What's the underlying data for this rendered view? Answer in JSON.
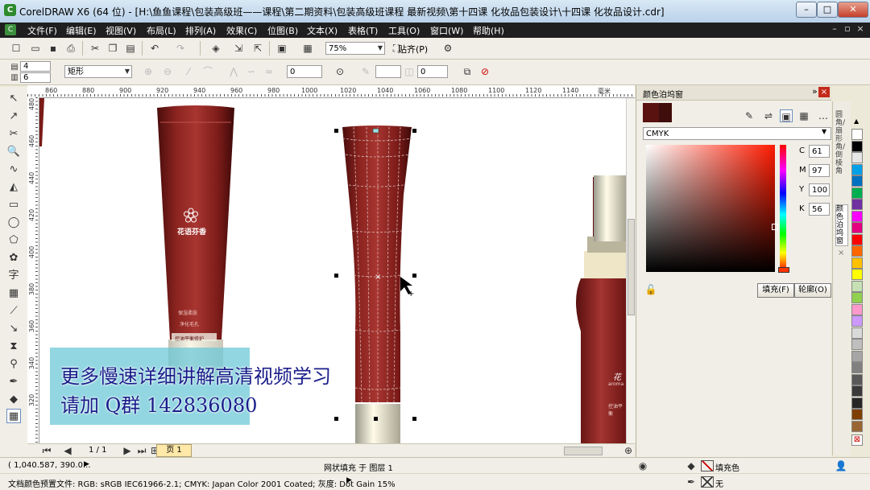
{
  "window": {
    "title": "CorelDRAW X6 (64 位) - [H:\\鱼鱼课程\\包装高级班——课程\\第二期资料\\包装高级班课程 最新视频\\第十四课 化妆品包装设计\\十四课 化妆品设计.cdr]",
    "minimize": "–",
    "maximize": "□",
    "close": "✕"
  },
  "menu": {
    "items": [
      "文件(F)",
      "编辑(E)",
      "视图(V)",
      "布局(L)",
      "排列(A)",
      "效果(C)",
      "位图(B)",
      "文本(X)",
      "表格(T)",
      "工具(O)",
      "窗口(W)",
      "帮助(H)"
    ]
  },
  "toolbar": {
    "zoom_value": "75%",
    "snap_label": "贴齐(P)"
  },
  "propbar": {
    "rows_value": "4",
    "cols_value": "6",
    "shape_select": "矩形",
    "angle_value": "0",
    "transparency_value": "0"
  },
  "ruler": {
    "h_ticks": [
      "860",
      "880",
      "900",
      "920",
      "940",
      "960",
      "980",
      "1000",
      "1020",
      "1040",
      "1060",
      "1080",
      "1100",
      "1120",
      "1140"
    ],
    "h_unit": "毫米",
    "v_ticks": [
      "480",
      "460",
      "440",
      "420",
      "400",
      "380",
      "360",
      "340",
      "320"
    ]
  },
  "canvas": {
    "tube_brand": "花语芬香",
    "tube_small1": "保湿柔肤",
    "tube_small2": "净化毛孔",
    "tube_small3": "控油平衡修护",
    "right_brand": "花",
    "right_small1": "aroma",
    "right_small2": "控油平衡"
  },
  "overlay": {
    "line1": "更多慢速详细讲解高清视频学习",
    "line2": "请加  Q群  142836080"
  },
  "docker": {
    "title": "颜色泊坞窗",
    "color_model": "CMYK",
    "c_label": "C",
    "c_value": "61",
    "m_label": "M",
    "m_value": "97",
    "y_label": "Y",
    "y_value": "100",
    "k_label": "K",
    "k_value": "56",
    "fill_button": "填充(F)",
    "outline_button": "轮廓(O)",
    "side_tab1": "圆角/扇形角/倒棱角",
    "side_tab2": "颜色泊坞窗",
    "current_color": "#5a1210"
  },
  "pagenav": {
    "page_count": "1 / 1",
    "page_tab": "页 1"
  },
  "status": {
    "coords": "( 1,040.587, 390.0...",
    "object_info": "网状填充 于 图层 1",
    "fill_label": "填充色",
    "outline_label": "无",
    "color_profile": "文档颜色预置文件: RGB: sRGB IEC61966-2.1; CMYK: Japan Color 2001 Coated; 灰度: Dot Gain 15%"
  },
  "palette": [
    "#ffffff",
    "#000000",
    "#e6e6e6",
    "#00a0e9",
    "#0070c0",
    "#00b050",
    "#7030a0",
    "#ff00ff",
    "#e4007f",
    "#ff0000",
    "#ff6600",
    "#ffc000",
    "#ffff00",
    "#c6e0b4",
    "#92d050",
    "#ff99cc",
    "#cc99ff",
    "#d9d9d9",
    "#bfbfbf",
    "#a6a6a6",
    "#808080",
    "#595959",
    "#3a3a3a",
    "#262626",
    "#7f3f00",
    "#996633"
  ]
}
